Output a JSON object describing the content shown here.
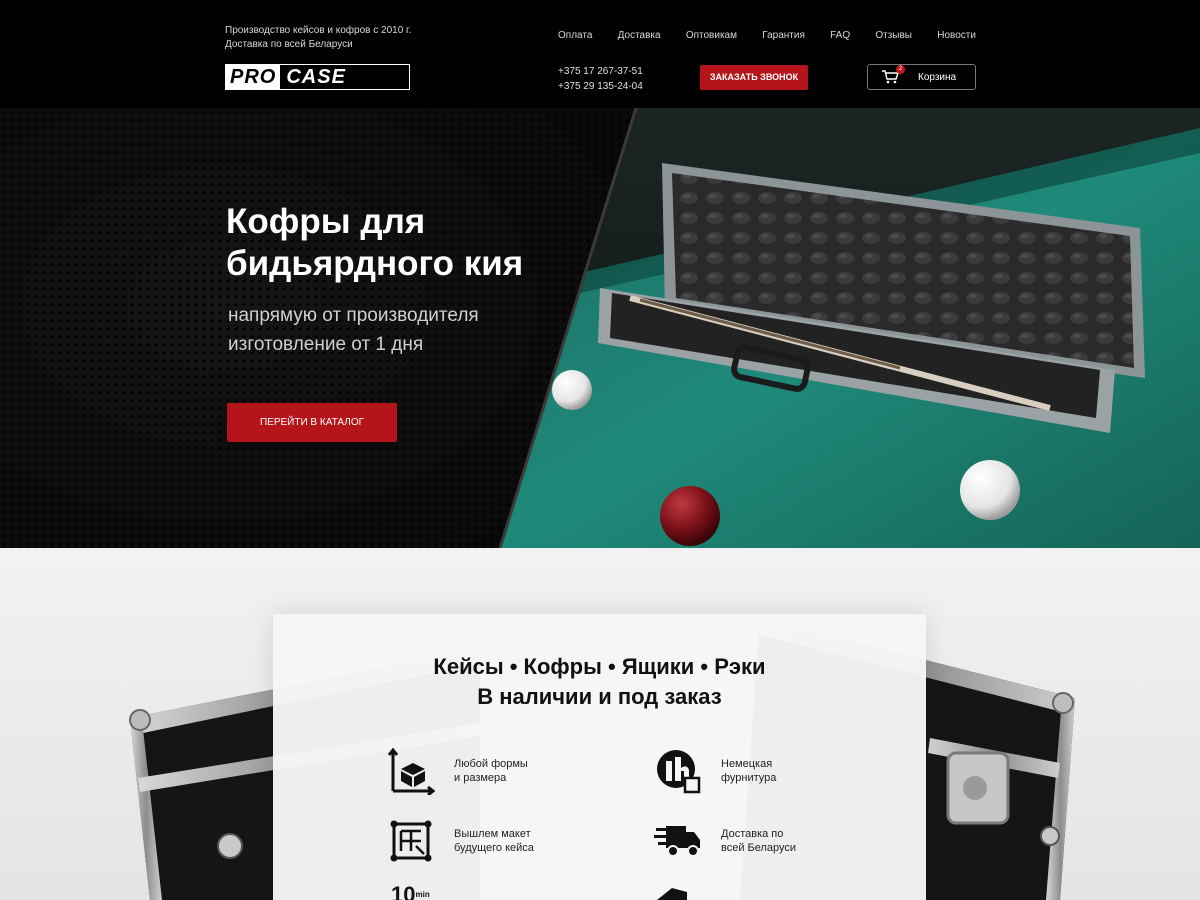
{
  "header": {
    "tagline_line1": "Производство кейсов и кофров с 2010 г.",
    "tagline_line2": "Доставка по всей Беларуси",
    "logo_pro": "PRO",
    "logo_case": "CASE",
    "nav": [
      "Оплата",
      "Доставка",
      "Оптовикам",
      "Гарантия",
      "FAQ",
      "Отзывы",
      "Новости"
    ],
    "phone1": "+375 17 267-37-51",
    "phone2": "+375 29 135-24-04",
    "call_button": "ЗАКАЗАТЬ ЗВОНОК",
    "cart_label": "Корзина",
    "cart_count": "2"
  },
  "hero": {
    "title_line1": "Кофры для",
    "title_line2": "бидьярдного кия",
    "subtitle_line1": "напрямую от производителя",
    "subtitle_line2": "изготовление от 1 дня",
    "catalog_button": "ПЕРЕЙТИ В КАТАЛОГ"
  },
  "features": {
    "title_line1": "Кейсы • Кофры • Ящики • Рэки",
    "title_line2": "В наличии и под заказ",
    "items": [
      {
        "line1": "Любой формы",
        "line2": "и размера",
        "icon": "cube-dimensions-icon"
      },
      {
        "line1": "Немецкая",
        "line2": "фурнитура",
        "icon": "german-hardware-icon"
      },
      {
        "line1": "Вышлем макет",
        "line2": "будущего кейса",
        "icon": "layout-icon"
      },
      {
        "line1": "Доставка по",
        "line2": "всей Беларуси",
        "icon": "truck-icon"
      }
    ],
    "partial_icon_text": "10",
    "partial_icon_unit": "min"
  },
  "colors": {
    "accent": "#b5151a",
    "header_bg": "#000000",
    "felt": "#1f8a7a"
  }
}
